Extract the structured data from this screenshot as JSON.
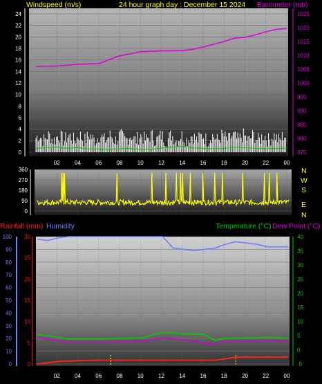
{
  "colors": {
    "background": "#000000",
    "wind": "#c8c8c8",
    "gust": "#ffffff",
    "wind_avg": "#00d000",
    "barometer": "#e000e0",
    "direction": "#ffff00",
    "rainfall": "#ff2020",
    "humidity": "#7080ff",
    "temperature": "#00d000",
    "dew_point": "#d000d0",
    "header_text": "#ffff00"
  },
  "top_panel": {
    "left_title": "Windspeed (m/s)",
    "center_title": "24 hour graph day : December 15 2024",
    "right_title": "Barometer (mb)"
  },
  "direction_panel": {
    "compass_labels": [
      "N",
      "W",
      "S",
      "E",
      "N"
    ]
  },
  "bottom_panel": {
    "rain_title": "Rainfall (mm)",
    "humidity_title": "Humidity",
    "temperature_title": "Temperature (°C)",
    "dewpoint_title": "Dew Point (°C)"
  },
  "chart_data": [
    {
      "type": "line",
      "title": "24 hour graph day : December 15 2024",
      "x_ticks": [
        "02",
        "04",
        "06",
        "08",
        "10",
        "12",
        "14",
        "16",
        "18",
        "20",
        "22",
        "00"
      ],
      "y_left": {
        "label": "Windspeed (m/s)",
        "range": [
          0,
          25
        ],
        "ticks": [
          0,
          2,
          4,
          6,
          8,
          10,
          12,
          14,
          16,
          18,
          20,
          22,
          24
        ]
      },
      "y_right": {
        "label": "Barometer (mb)",
        "range": [
          973,
          1025
        ],
        "ticks": [
          975,
          980,
          985,
          990,
          995,
          1000,
          1005,
          1010,
          1015,
          1020,
          1025
        ]
      },
      "series": [
        {
          "name": "Barometer (mb)",
          "axis": "right",
          "x": [
            0,
            2,
            4,
            6,
            7,
            8,
            10,
            12,
            14,
            15,
            16,
            17,
            18,
            19,
            20,
            21,
            22,
            23,
            24
          ],
          "values": [
            1006,
            1006.1,
            1006.8,
            1007,
            1008.5,
            1009.8,
            1011.3,
            1011.6,
            1011.7,
            1012.2,
            1013,
            1014,
            1015,
            1016.2,
            1016.5,
            1017.4,
            1018.5,
            1019.4,
            1019.7
          ]
        },
        {
          "name": "Windspeed (m/s)",
          "axis": "left",
          "x": [
            0,
            1,
            2,
            3,
            4,
            5,
            6,
            7,
            8,
            9,
            10,
            11,
            12,
            13,
            14,
            15,
            16,
            17,
            18,
            19,
            20,
            21,
            22,
            23,
            24
          ],
          "values": [
            1.2,
            1.4,
            1.6,
            1.2,
            1.5,
            1.1,
            1.0,
            0.9,
            1.1,
            1.2,
            0.8,
            0.9,
            1.3,
            1.6,
            1.9,
            1.4,
            1.2,
            1.1,
            1.2,
            1.6,
            1.4,
            1.2,
            1.1,
            1.2,
            1.3
          ]
        }
      ]
    },
    {
      "type": "line",
      "y_left": {
        "range": [
          0,
          360
        ],
        "ticks": [
          0,
          90,
          180,
          270,
          360
        ]
      },
      "x_ticks": [
        "02",
        "04",
        "06",
        "08",
        "10",
        "12",
        "14",
        "16",
        "18",
        "20",
        "22",
        "00"
      ],
      "series": [
        {
          "name": "Wind direction",
          "typical": 75,
          "spikes": [
            3.3,
            3.5,
            3.7,
            10.8,
            15.5,
            17.4,
            18.8,
            19.4,
            19.6,
            20.7,
            22.4,
            24.0,
            25.0,
            27.8,
            30.7,
            31.4,
            32.4
          ]
        }
      ]
    },
    {
      "type": "line",
      "x_ticks": [
        "02",
        "04",
        "06",
        "08",
        "10",
        "12",
        "14",
        "16",
        "18",
        "20",
        "22",
        "00"
      ],
      "y_left": {
        "label": "Rainfall (mm)",
        "range": [
          0,
          30
        ],
        "ticks": [
          0,
          5,
          10,
          15,
          20,
          25,
          30
        ]
      },
      "y_humidity": {
        "label": "Humidity",
        "range": [
          0,
          100
        ],
        "ticks": [
          0,
          10,
          20,
          30,
          40,
          50,
          60,
          70,
          80,
          90,
          100
        ]
      },
      "y_right": {
        "label": "Temperature (°C)",
        "range": [
          -5,
          40
        ],
        "ticks": [
          -5,
          0,
          5,
          10,
          15,
          20,
          25,
          30,
          35,
          40
        ]
      },
      "series": [
        {
          "name": "Humidity",
          "axis": "humidity",
          "x": [
            0,
            1,
            2,
            3,
            4,
            6,
            8,
            10,
            12,
            13,
            14,
            15,
            16,
            17,
            18,
            19,
            20,
            21,
            22,
            23,
            24
          ],
          "values": [
            98,
            97,
            99,
            100,
            100,
            100,
            100,
            100,
            100,
            91,
            90,
            89,
            90,
            91,
            94,
            96,
            95,
            94,
            92,
            92,
            92
          ]
        },
        {
          "name": "Temperature (°C)",
          "axis": "right",
          "x": [
            0,
            2,
            3,
            4,
            6,
            8,
            10,
            12,
            13,
            14,
            15,
            16,
            17,
            18,
            20,
            22,
            24
          ],
          "values": [
            5.4,
            4.5,
            3.8,
            3.8,
            3.8,
            4.0,
            4.2,
            6.2,
            6.0,
            5.6,
            5.6,
            5.4,
            3.3,
            4.0,
            4.2,
            4.4,
            4.1
          ]
        },
        {
          "name": "Dew Point (°C)",
          "axis": "right",
          "x": [
            0,
            2,
            3,
            4,
            6,
            8,
            10,
            12,
            13,
            14,
            15,
            16,
            17,
            18,
            20,
            22,
            24
          ],
          "values": [
            4.5,
            3.2,
            2.7,
            2.7,
            2.7,
            2.9,
            3.1,
            4.2,
            3.8,
            3.5,
            3.1,
            2.3,
            2.0,
            3.0,
            3.0,
            3.3,
            3.2
          ]
        },
        {
          "name": "Rainfall (mm)",
          "axis": "left",
          "x": [
            0,
            1,
            2,
            4,
            6,
            8,
            10,
            12,
            14,
            16,
            17,
            18,
            19,
            20,
            22,
            24
          ],
          "values": [
            0,
            0.3,
            0.6,
            0.8,
            0.9,
            0.9,
            0.9,
            0.9,
            0.9,
            0.9,
            0.9,
            1.2,
            1.6,
            1.6,
            1.6,
            1.6
          ]
        }
      ]
    }
  ]
}
